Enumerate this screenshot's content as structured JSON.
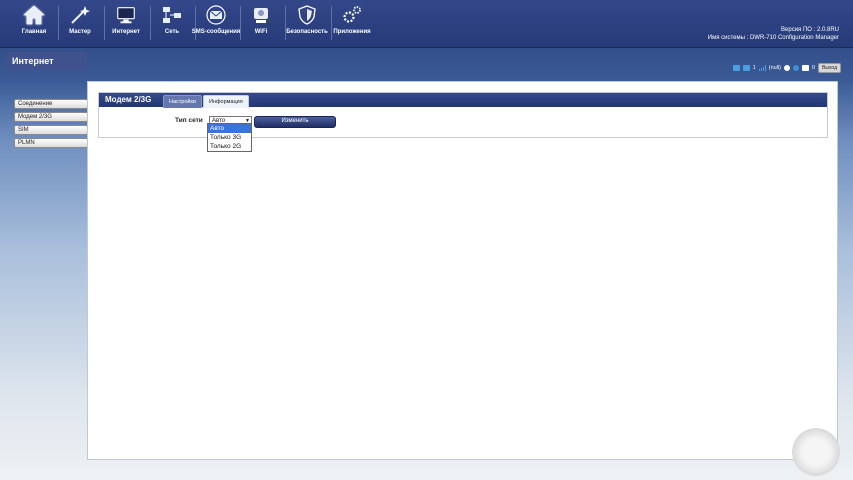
{
  "nav": [
    {
      "label": "Главная",
      "icon": "home-icon"
    },
    {
      "label": "Мастер",
      "icon": "wizard-icon"
    },
    {
      "label": "Интернет",
      "icon": "internet-icon"
    },
    {
      "label": "Сеть",
      "icon": "network-icon"
    },
    {
      "label": "SMS-сообщения",
      "icon": "sms-icon"
    },
    {
      "label": "WiFi",
      "icon": "wifi-icon"
    },
    {
      "label": "Безопасность",
      "icon": "security-icon"
    },
    {
      "label": "Приложения",
      "icon": "apps-icon"
    }
  ],
  "firmware": {
    "version_label": "Версия ПО",
    "version_value": "2.0.8RU",
    "system_label": "Имя системы",
    "system_value": "DWR-710 Configuration Manager"
  },
  "section_title": "Интернет",
  "sidebar": [
    {
      "label": "Соединение"
    },
    {
      "label": "Модем 2/3G"
    },
    {
      "label": "SIM"
    },
    {
      "label": "PLMN"
    }
  ],
  "status": {
    "sms_count": "1",
    "network": "(null)",
    "unread": "0",
    "logout": "Выход"
  },
  "panel": {
    "title": "Модем 2/3G",
    "tabs": [
      {
        "label": "Настройки"
      },
      {
        "label": "Информация"
      }
    ],
    "network_type_label": "Тип сети",
    "network_type_value": "Авто",
    "options": [
      "Авто",
      "Только 3G",
      "Только 2G"
    ],
    "apply_button": "Изменить"
  },
  "colors": {
    "header": "#2b3e7e",
    "accent": "#3875d7"
  }
}
